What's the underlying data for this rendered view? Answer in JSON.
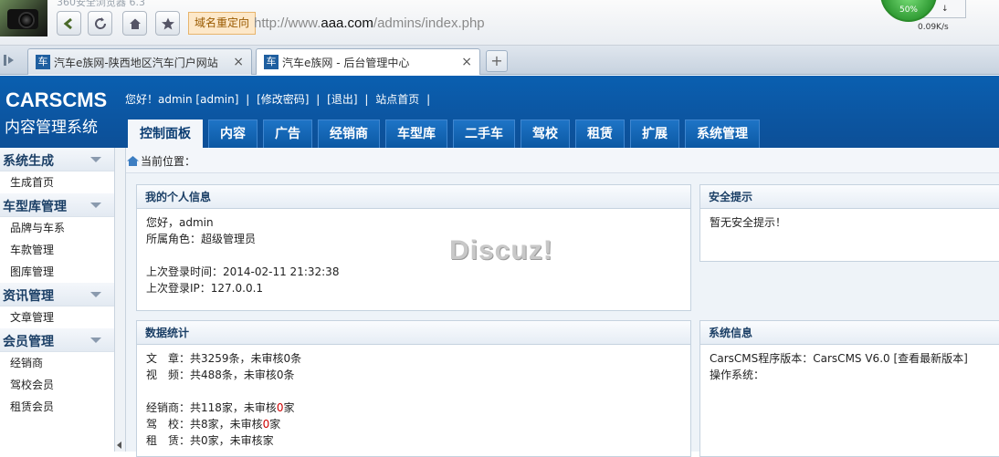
{
  "browser": {
    "title_faint": "360安全浏览器 6.3",
    "redirect_badge": "域名重定向",
    "url_prefix": "http://www.",
    "url_domain": "aaa.com",
    "url_path": "/admins/index.php",
    "speed_percent": "50%",
    "speed_rate": "↓ 0.09K/s",
    "tabs": [
      {
        "icon_text": "车",
        "label": "汽车e族网-陕西地区汽车门户网站",
        "close": "×"
      },
      {
        "icon_text": "车",
        "label": "汽车e族网 - 后台管理中心",
        "close": "×"
      }
    ],
    "new_tab": "+"
  },
  "header": {
    "logo_en": "CARSCMS",
    "logo_cn": "内容管理系统",
    "user_bar": [
      "您好！admin [admin]",
      "|",
      "[修改密码]",
      "|",
      "[退出]",
      "|",
      "站点首页",
      "|"
    ],
    "nav": [
      "控制面板",
      "内容",
      "广告",
      "经销商",
      "车型库",
      "二手车",
      "驾校",
      "租赁",
      "扩展",
      "系统管理"
    ]
  },
  "sidebar": {
    "groups": [
      {
        "title": "系统生成",
        "items": [
          "生成首页"
        ]
      },
      {
        "title": "车型库管理",
        "items": [
          "品牌与车系",
          "车款管理",
          "图库管理"
        ]
      },
      {
        "title": "资讯管理",
        "items": [
          "文章管理"
        ]
      },
      {
        "title": "会员管理",
        "items": [
          "经销商",
          "驾校会员",
          "租赁会员"
        ]
      }
    ]
  },
  "main": {
    "breadcrumb": "当前位置：",
    "info_panel": {
      "title": "我的个人信息",
      "greeting": "您好，admin",
      "role": "所属角色：超级管理员",
      "last_login_time": "上次登录时间：2014-02-11 21:32:38",
      "last_login_ip": "上次登录IP：127.0.0.1"
    },
    "security_panel": {
      "title": "安全提示",
      "text": "暂无安全提示！"
    },
    "stats_panel": {
      "title": "数据统计",
      "lines": [
        "文　章：共3259条，未审核0条",
        "视　频：共488条，未审核0条"
      ],
      "lines2": [
        {
          "pre": "经销商：共118家，未审核",
          "num": "0",
          "post": "家"
        },
        {
          "pre": "驾　校：共8家，未审核",
          "num": "0",
          "post": "家"
        },
        {
          "pre": "租　赁：共0家，未审核家",
          "num": "",
          "post": ""
        }
      ]
    },
    "sysinfo_panel": {
      "title": "系统信息",
      "version": "CarsCMS程序版本：CarsCMS V6.0 [查看最新版本]",
      "os": "操作系统："
    },
    "watermark": "Discuz!"
  }
}
